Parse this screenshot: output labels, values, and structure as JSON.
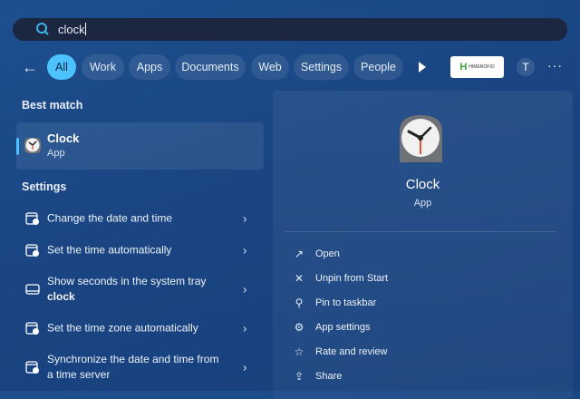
{
  "search": {
    "value": "clock"
  },
  "filters": {
    "back_label": "←",
    "items": [
      "All",
      "Work",
      "Apps",
      "Documents",
      "Web",
      "Settings",
      "People"
    ],
    "active": "All",
    "logo_text": "HIMEROFIO",
    "avatar": "T",
    "more": "···"
  },
  "best_match": {
    "heading": "Best match",
    "title": "Clock",
    "subtitle": "App"
  },
  "settings": {
    "heading": "Settings",
    "items": [
      {
        "label": "Change the date and time"
      },
      {
        "label": "Set the time automatically"
      },
      {
        "label_pre": "Show seconds in the system tray ",
        "label_bold": "clock"
      },
      {
        "label": "Set the time zone automatically"
      },
      {
        "label": "Synchronize the date and time from a time server"
      }
    ]
  },
  "detail": {
    "title": "Clock",
    "subtitle": "App",
    "actions": [
      {
        "label": "Open",
        "icon": "open-external-icon"
      },
      {
        "label": "Unpin from Start",
        "icon": "unpin-icon"
      },
      {
        "label": "Pin to taskbar",
        "icon": "pin-icon"
      },
      {
        "label": "App settings",
        "icon": "gear-icon"
      },
      {
        "label": "Rate and review",
        "icon": "star-list-icon"
      },
      {
        "label": "Share",
        "icon": "share-icon"
      }
    ]
  },
  "colors": {
    "accent": "#4cc2ff",
    "search_bg": "#1b2740",
    "second_hand": "#e0401f"
  }
}
